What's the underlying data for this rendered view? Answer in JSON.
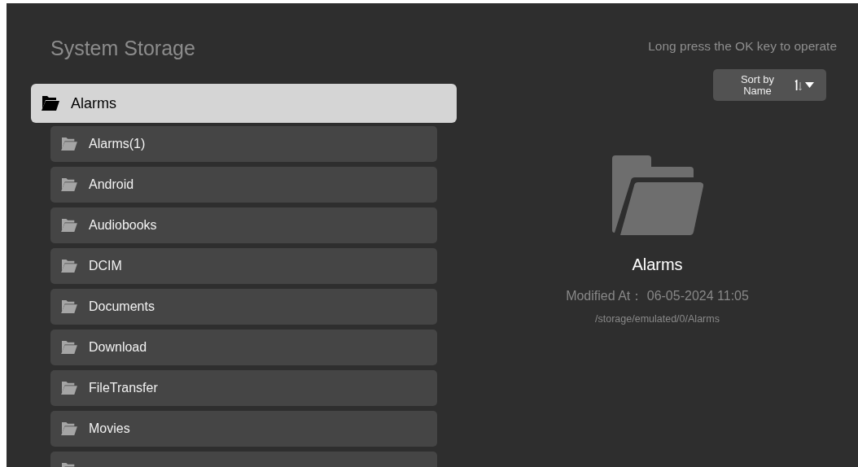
{
  "title": "System Storage",
  "hint": "Long press the OK key to operate",
  "sort": {
    "label": "Sort by Name"
  },
  "folders": [
    {
      "name": "Alarms",
      "selected": true
    },
    {
      "name": "Alarms(1)",
      "selected": false
    },
    {
      "name": "Android",
      "selected": false
    },
    {
      "name": "Audiobooks",
      "selected": false
    },
    {
      "name": "DCIM",
      "selected": false
    },
    {
      "name": "Documents",
      "selected": false
    },
    {
      "name": "Download",
      "selected": false
    },
    {
      "name": "FileTransfer",
      "selected": false
    },
    {
      "name": "Movies",
      "selected": false
    },
    {
      "selected": false
    }
  ],
  "details": {
    "name": "Alarms",
    "modified_label": "Modified At：",
    "modified": "06-05-2024 11:05",
    "path": "/storage/emulated/0/Alarms"
  }
}
